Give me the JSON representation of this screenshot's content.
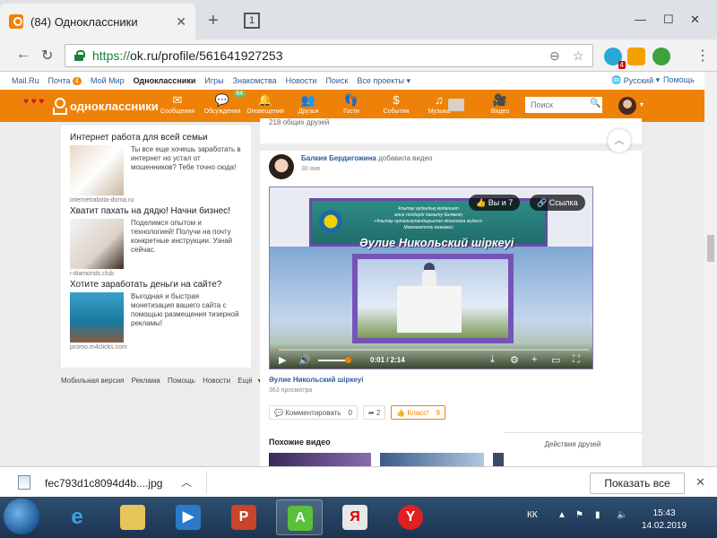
{
  "browser": {
    "tab_title": "(84) Одноклассники",
    "tab_count": "1",
    "url_scheme": "https://",
    "url_rest": "ok.ru/profile/561641927253",
    "ext_badge": "4"
  },
  "topnav": {
    "items": [
      "Mail.Ru",
      "Почта",
      "Мой Мир",
      "Одноклассники",
      "Игры",
      "Знакомства",
      "Новости",
      "Поиск",
      "Все проекты"
    ],
    "mail_count": "4",
    "lang": "Русский",
    "help": "Помощь"
  },
  "okbar": {
    "logo": "одноклассники",
    "items": [
      {
        "label": "Сообщения",
        "icon": "envelope-icon"
      },
      {
        "label": "Обсуждения",
        "icon": "chat-icon",
        "badge": "84"
      },
      {
        "label": "Оповещения",
        "icon": "bell-icon"
      },
      {
        "label": "Друзья",
        "icon": "friends-icon"
      },
      {
        "label": "Гости",
        "icon": "footprints-icon"
      },
      {
        "label": "События",
        "icon": "events-icon"
      },
      {
        "label": "Музыка",
        "icon": "music-icon"
      },
      {
        "label": "Видео",
        "icon": "video-icon"
      }
    ],
    "search_placeholder": "Поиск"
  },
  "ads": [
    {
      "title": "Интернет работа для всей семьи",
      "desc": "Ты все еще хочешь заработать в интернет но устал от мошенников? Тебе точно сюда!",
      "domain": "internetrabota-doma.ru"
    },
    {
      "title": "Хватит пахать на дядю! Начни бизнес!",
      "desc": "Поделимся опытом и технологией! Получи на почту конкретные инструкции. Узнай сейчас.",
      "domain": "i-diamonds.club"
    },
    {
      "title": "Хотите заработать деньги на сайте?",
      "desc": "Выгодная и быстрая монетизация вашего сайта с помощью размещения тизерной рекламы!",
      "domain": "promo.m4clicks.com"
    }
  ],
  "adfoot": [
    "Мобильная версия",
    "Реклама",
    "Помощь",
    "Новости",
    "Ещё"
  ],
  "feed": {
    "friends_line": "218 общих друзей",
    "author": "Балкия Бердигожина",
    "action": "добавила видео",
    "date": "30 янв",
    "video": {
      "banner_lines": [
        "Ұлытау аудандық мәдениет",
        "және тілдерді дамыту бөлімінің",
        "«Ұлытау орталықтандырылған кітапхана жүйесі»",
        "Мемлекеттік мекемесі"
      ],
      "overlay_title": "Әулие Никольский шіркеуі",
      "pill_you": "Вы и 7",
      "pill_link": "Ссылка",
      "time": "0:01 / 2:14",
      "progress": 0.01
    },
    "title": "Әулие Никольский шіркеуі",
    "views": "363 просмотра",
    "comment_label": "Комментировать",
    "comment_count": "0",
    "share_count": "2",
    "klass_label": "Класс!",
    "klass_count": "9",
    "similar": "Похожие видео",
    "friends_actions": "Действия друзей"
  },
  "download": {
    "filename": "fec793d1c8094d4b....jpg",
    "show_all": "Показать все"
  },
  "taskbar": {
    "lang": "КК",
    "time": "15:43",
    "date": "14.02.2019"
  }
}
